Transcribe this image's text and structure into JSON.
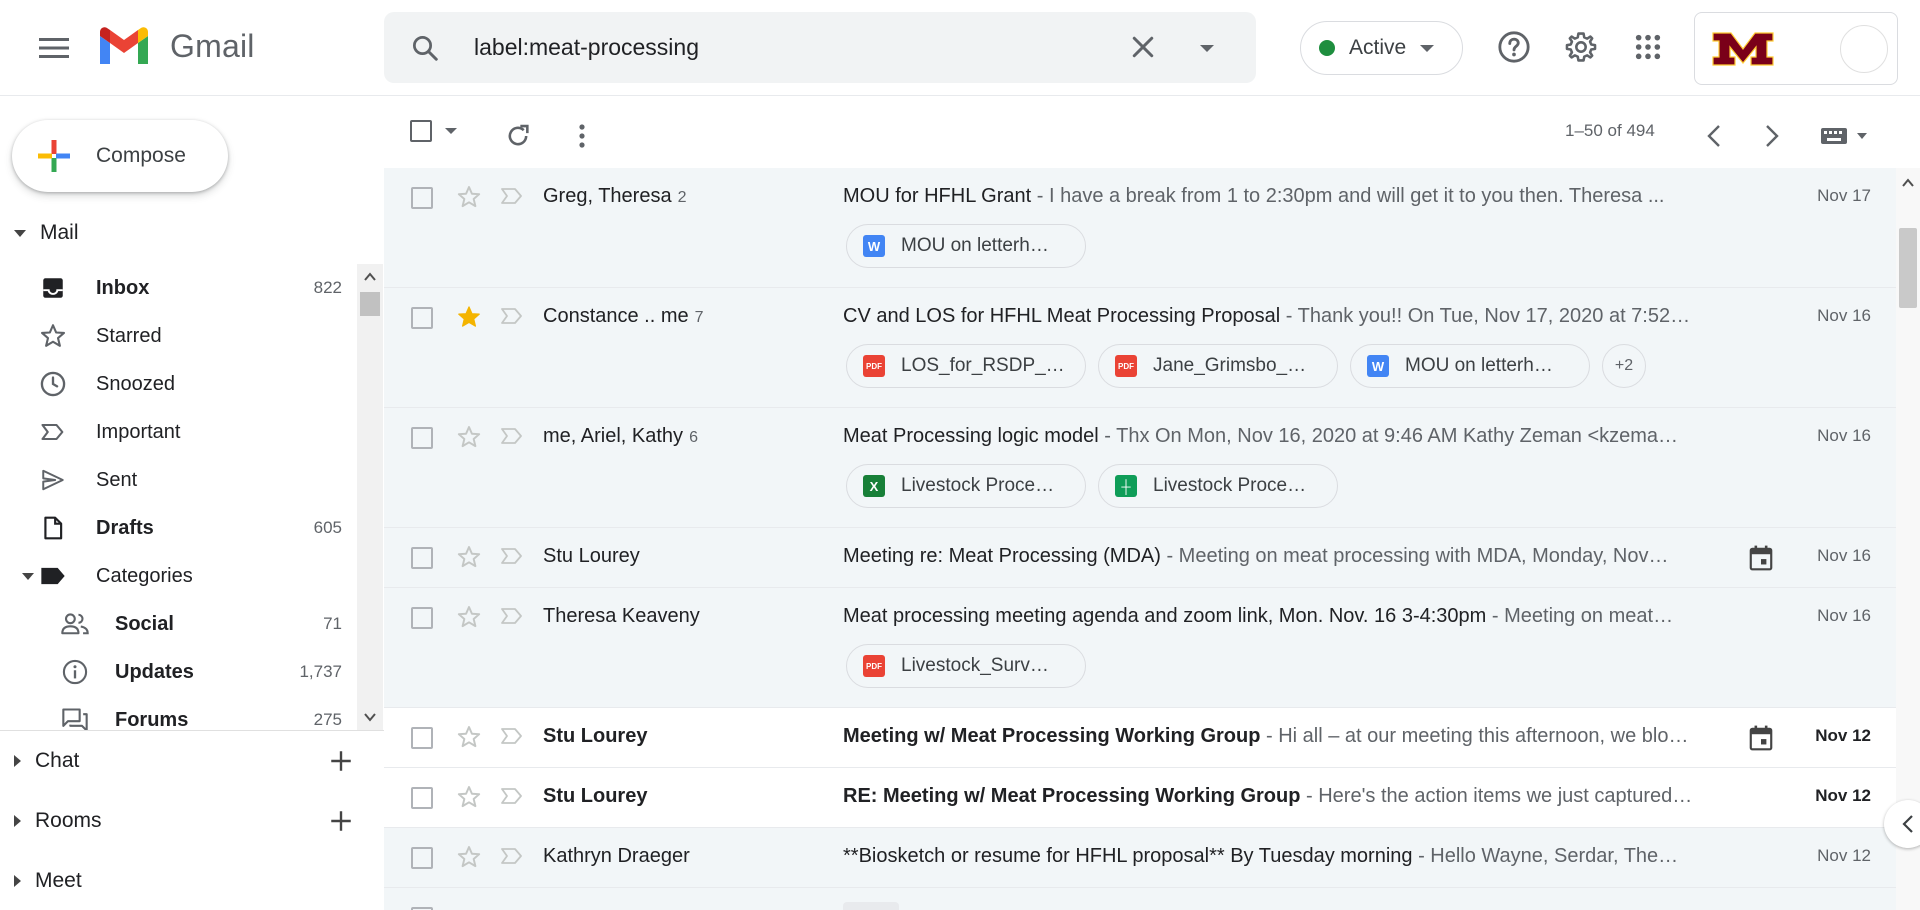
{
  "app": {
    "name": "Gmail"
  },
  "search": {
    "query": "label:meat-processing"
  },
  "status": {
    "label": "Active"
  },
  "pagination": {
    "range": "1–50 of 494"
  },
  "compose": {
    "label": "Compose"
  },
  "sections": {
    "mail": "Mail",
    "chat": "Chat",
    "rooms": "Rooms",
    "meet": "Meet"
  },
  "nav": [
    {
      "label": "Inbox",
      "count": "822"
    },
    {
      "label": "Starred",
      "count": ""
    },
    {
      "label": "Snoozed",
      "count": ""
    },
    {
      "label": "Important",
      "count": ""
    },
    {
      "label": "Sent",
      "count": ""
    },
    {
      "label": "Drafts",
      "count": "605"
    },
    {
      "label": "Categories",
      "count": ""
    },
    {
      "label": "Social",
      "count": "71"
    },
    {
      "label": "Updates",
      "count": "1,737"
    },
    {
      "label": "Forums",
      "count": "275"
    }
  ],
  "emails": [
    {
      "sender": "Greg, Theresa",
      "count": "2",
      "subject": "MOU for HFHL Grant",
      "snippet": " - I have a break from 1 to 2:30pm and will get it to you then. Theresa ...",
      "date": "Nov 17",
      "attachments": [
        {
          "type": "word",
          "name": "MOU on letterh…"
        }
      ]
    },
    {
      "sender": "Constance .. me",
      "count": "7",
      "subject": "CV and LOS for HFHL Meat Processing Proposal",
      "snippet": " - Thank you!! On Tue, Nov 17, 2020 at 7:52…",
      "date": "Nov 16",
      "attachments": [
        {
          "type": "pdf",
          "name": "LOS_for_RSDP_…"
        },
        {
          "type": "pdf",
          "name": "Jane_Grimsbo_…"
        },
        {
          "type": "word",
          "name": "MOU on letterh…"
        }
      ],
      "more": "+2"
    },
    {
      "sender": "me, Ariel, Kathy",
      "count": "6",
      "subject": "Meat Processing logic model",
      "snippet": " - Thx On Mon, Nov 16, 2020 at 9:46 AM Kathy Zeman <kzema…",
      "date": "Nov 16",
      "attachments": [
        {
          "type": "xls",
          "name": "Livestock Proce…"
        },
        {
          "type": "sheet",
          "name": "Livestock Proce…"
        }
      ]
    },
    {
      "sender": "Stu Lourey",
      "count": "",
      "subject": "Meeting re: Meat Processing (MDA)",
      "snippet": " - Meeting on meat processing with MDA, Monday, Nov…",
      "date": "Nov 16"
    },
    {
      "sender": "Theresa Keaveny",
      "count": "",
      "subject": "Meat processing meeting agenda and zoom link, Mon. Nov. 16 3-4:30pm",
      "snippet": " - Meeting on meat…",
      "date": "Nov 16",
      "attachments": [
        {
          "type": "pdf",
          "name": "Livestock_Surv…"
        }
      ]
    },
    {
      "sender": "Stu Lourey",
      "count": "",
      "subject": "Meeting w/ Meat Processing Working Group",
      "snippet": " - Hi all – at our meeting this afternoon, we blo…",
      "date": "Nov 12"
    },
    {
      "sender": "Stu Lourey",
      "count": "",
      "subject": "RE: Meeting w/ Meat Processing Working Group",
      "snippet": " - Here's the action items we just captured…",
      "date": "Nov 12"
    },
    {
      "sender": "Kathryn Draeger",
      "count": "",
      "subject": "**Biosketch or resume for HFHL proposal** By Tuesday morning",
      "snippet": " - Hello Wayne, Serdar, The…",
      "date": "Nov 12"
    }
  ],
  "colors": {
    "accent": "#1a73e8",
    "star": "#f4b400",
    "active": "#1e8e3e",
    "umn": "#7a0019"
  }
}
